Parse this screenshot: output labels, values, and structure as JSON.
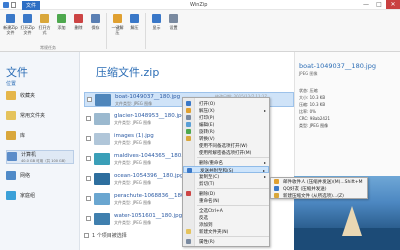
{
  "window": {
    "file_tab": "文件",
    "title": "WinZip",
    "minimize": "—",
    "maximize": "□",
    "close": "✕"
  },
  "ribbon": {
    "buttons": [
      {
        "label": "新建Zip文件",
        "icon": "new-zip-icon"
      },
      {
        "label": "打开Zip文件",
        "icon": "open-zip-icon"
      },
      {
        "label": "打开方式",
        "icon": "open-with-icon"
      },
      {
        "label": "添加",
        "icon": "add-icon"
      },
      {
        "label": "删除",
        "icon": "delete-icon"
      },
      {
        "label": "保存",
        "icon": "save-icon"
      },
      {
        "label": "一键解压",
        "icon": "extract-icon"
      },
      {
        "label": "解压",
        "icon": "unzip-icon"
      },
      {
        "label": "显示",
        "icon": "view-icon"
      },
      {
        "label": "设置",
        "icon": "settings-icon"
      }
    ],
    "group_label": "常规任务"
  },
  "nav": {
    "title": "文件",
    "subtitle": "位置",
    "items": [
      {
        "label": "收藏夹",
        "icon": "favorites-icon",
        "color": "#e5b64a"
      },
      {
        "label": "常用文件夹",
        "icon": "folder-icon",
        "color": "#e5c35c"
      },
      {
        "label": "库",
        "icon": "library-icon",
        "color": "#d9a73b"
      },
      {
        "label": "计算机",
        "icon": "computer-icon",
        "color": "#5b8cc9",
        "sub": "40.0 GB 可用（共 100 GB）"
      },
      {
        "label": "网络",
        "icon": "network-icon",
        "color": "#4f8ac8"
      },
      {
        "label": "家庭组",
        "icon": "homegroup-icon",
        "color": "#3aa0d8"
      }
    ]
  },
  "content": {
    "title": "压缩文件.zip"
  },
  "files": [
    {
      "name": "boat-1049037__180.jpg",
      "type": "文件类型: JPEG 图像",
      "date": "修改日期: 2015/12/7 11:17",
      "thumb": "#4f86bb"
    },
    {
      "name": "glacier-1048953__180.jpg",
      "type": "文件类型: JPEG 图像",
      "date": "",
      "thumb": "#9bb9cf"
    },
    {
      "name": "images (1).jpg",
      "type": "文件类型: JPEG 图像",
      "date": "",
      "thumb": "#b0c6d9"
    },
    {
      "name": "maldives-1044365__180.jpg",
      "type": "文件类型: JPEG 图像",
      "date": "",
      "thumb": "#3a9fb8"
    },
    {
      "name": "ocean-1054396__180.jpg",
      "type": "文件类型: JPEG 图像",
      "date": "",
      "thumb": "#2d6e9e"
    },
    {
      "name": "perachute-1068836__180.jpg",
      "type": "文件类型: JPEG 图像",
      "date": "",
      "thumb": "#6aa6d0"
    },
    {
      "name": "water-1051601__180.jpg",
      "type": "文件类型: JPEG 图像",
      "date": "",
      "thumb": "#3f7fae"
    }
  ],
  "list_footer": "1 个项目被选择",
  "context_menu": {
    "items": [
      {
        "label": "打开(O)",
        "icon": "open-icon",
        "type": "item"
      },
      {
        "label": "解压(X)",
        "icon": "extract-icon",
        "type": "item",
        "arrow": true
      },
      {
        "label": "打印(P)",
        "icon": "print-icon",
        "type": "item"
      },
      {
        "label": "编辑(E)",
        "icon": "edit-icon",
        "type": "item"
      },
      {
        "label": "旋转(R)",
        "icon": "rotate-icon",
        "type": "item"
      },
      {
        "label": "转换(V)",
        "icon": "convert-icon",
        "type": "item"
      },
      {
        "label": "使用不同备选项打开(W)",
        "icon": "",
        "type": "item"
      },
      {
        "label": "使用所解密备选项打开(M)",
        "icon": "",
        "type": "item"
      },
      {
        "label": "",
        "type": "sep"
      },
      {
        "label": "删除/重命名",
        "icon": "",
        "type": "item",
        "arrow": true
      },
      {
        "label": "发送并附至和(S)",
        "icon": "send-icon",
        "type": "item",
        "arrow": true,
        "highlight": true
      },
      {
        "label": "复制至(C)",
        "icon": "",
        "type": "item",
        "arrow": true
      },
      {
        "label": "剪切(T)",
        "icon": "",
        "type": "item"
      },
      {
        "label": "",
        "type": "sep"
      },
      {
        "label": "删除(D)",
        "icon": "delete-icon",
        "type": "item"
      },
      {
        "label": "重命名(N)",
        "icon": "",
        "type": "item"
      },
      {
        "label": "",
        "type": "sep"
      },
      {
        "label": "全选Ctrl+A",
        "icon": "",
        "type": "item"
      },
      {
        "label": "反选",
        "icon": "",
        "type": "item"
      },
      {
        "label": "添加到",
        "icon": "",
        "type": "item"
      },
      {
        "label": "新建文件夹(N)",
        "icon": "folder-icon",
        "type": "item"
      },
      {
        "label": "",
        "type": "sep"
      },
      {
        "label": "属性(R)",
        "icon": "properties-icon",
        "type": "item"
      }
    ]
  },
  "submenu": {
    "items": [
      {
        "label": "邮件收件人 (压缩并发送)(M)...Shift+M",
        "icon": "mail-icon"
      },
      {
        "label": "QQ好友 (压缩并发送)",
        "icon": "qq-icon"
      },
      {
        "label": "新建压缩文件 (从所选项)...(Z)",
        "icon": "zip-icon"
      }
    ]
  },
  "preview": {
    "name": "boat-1049037__180.jpg",
    "type": "JPEG 图像",
    "info": [
      "状态: 压缩",
      "大小: 10.3 KB",
      "压缩: 10.3 KB",
      "比率: 0%",
      "CRC: 98ab2421",
      "类型: JPEG 图像"
    ]
  }
}
